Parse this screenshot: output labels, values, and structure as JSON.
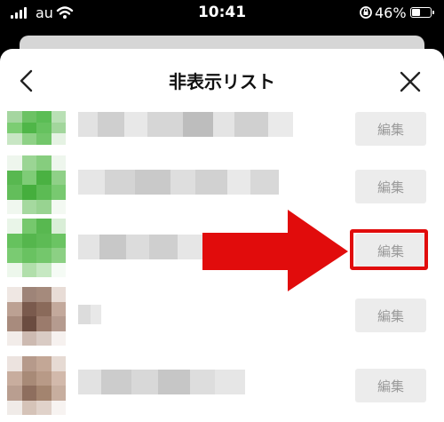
{
  "status_bar": {
    "carrier": "au",
    "time": "10:41",
    "battery_percent_text": "46%",
    "battery_level": 0.46
  },
  "header": {
    "title": "非表示リスト",
    "back_icon": "chevron-left-icon",
    "close_icon": "close-icon"
  },
  "hidden_list": {
    "items": [
      {
        "edit_label": "編集",
        "avatar_tone": "green"
      },
      {
        "edit_label": "編集",
        "avatar_tone": "green"
      },
      {
        "edit_label": "編集",
        "avatar_tone": "green"
      },
      {
        "edit_label": "編集",
        "avatar_tone": "brown"
      },
      {
        "edit_label": "編集",
        "avatar_tone": "brown"
      }
    ]
  },
  "annotation": {
    "arrow_icon": "red-arrow-right-icon",
    "highlight_color": "#e10c0c",
    "highlighted_item_index": 2
  },
  "colors": {
    "accent_red": "#e10c0c",
    "edit_button_bg": "#ececec",
    "edit_button_text": "#9a9a9a"
  }
}
